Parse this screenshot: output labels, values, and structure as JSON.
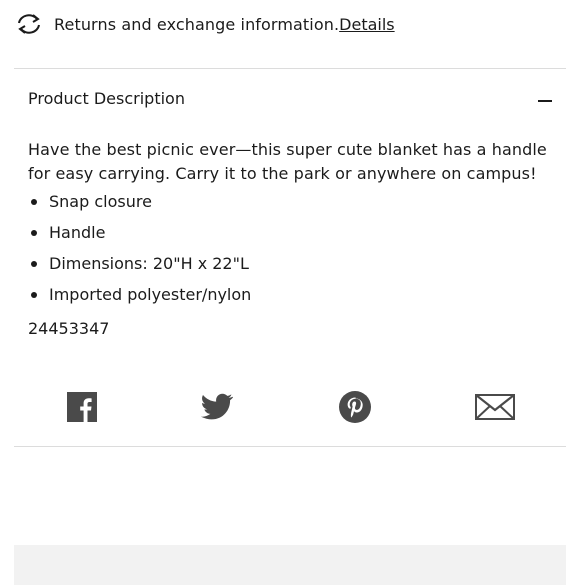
{
  "returns": {
    "text": "Returns and exchange information.",
    "link_label": "Details",
    "icon": "refresh-arrows-icon"
  },
  "accordion": {
    "title": "Product Description",
    "state_icon": "minus-icon"
  },
  "description": {
    "paragraph": "Have the best picnic ever—this super cute blanket has a handle for easy carrying. Carry it to the park or anywhere on campus!",
    "bullets": [
      "Snap closure",
      "Handle",
      "Dimensions: 20\"H x 22\"L",
      "Imported polyester/nylon"
    ],
    "sku": "24453347"
  },
  "share": {
    "icons": [
      "facebook-icon",
      "twitter-icon",
      "pinterest-icon",
      "email-icon"
    ]
  },
  "colors": {
    "text": "#1b1b1b",
    "icon": "#4a4a4a",
    "divider": "#dcdcdc",
    "panel": "#f2f2f2"
  }
}
